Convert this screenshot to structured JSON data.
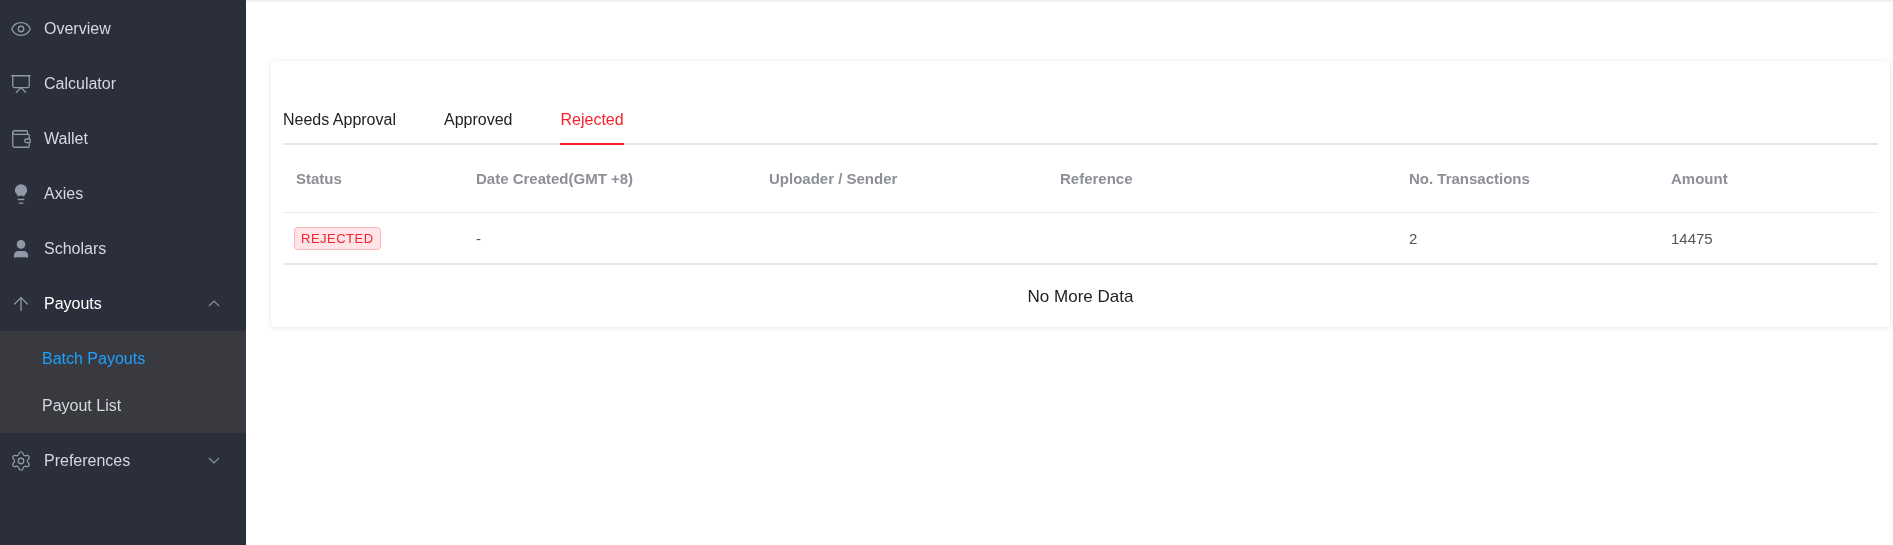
{
  "sidebar": {
    "items": [
      {
        "label": "Overview"
      },
      {
        "label": "Calculator"
      },
      {
        "label": "Wallet"
      },
      {
        "label": "Axies"
      },
      {
        "label": "Scholars"
      },
      {
        "label": "Payouts",
        "expanded": true,
        "children": [
          {
            "label": "Batch Payouts",
            "selected": true
          },
          {
            "label": "Payout List",
            "selected": false
          }
        ]
      },
      {
        "label": "Preferences",
        "expanded": false
      }
    ]
  },
  "tabs": [
    {
      "label": "Needs Approval",
      "selected": false
    },
    {
      "label": "Approved",
      "selected": false
    },
    {
      "label": "Rejected",
      "selected": true
    }
  ],
  "table": {
    "columns": [
      "Status",
      "Date Created(GMT +8)",
      "Uploader / Sender",
      "Reference",
      "No. Transactions",
      "Amount"
    ],
    "rows": [
      {
        "status": "REJECTED",
        "date_created": "-",
        "no_transactions": "2",
        "amount": "14475"
      }
    ]
  },
  "footer": "No More Data"
}
